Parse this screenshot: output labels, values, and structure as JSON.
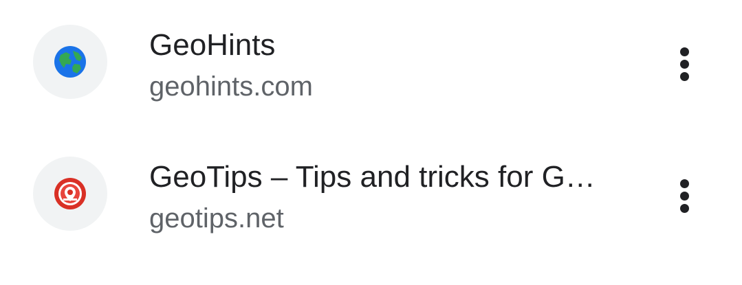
{
  "suggestions": [
    {
      "title": "GeoHints",
      "url": "geohints.com",
      "icon": "globe-icon",
      "icon_colors": {
        "ocean": "#1a73e8",
        "land": "#34a853"
      }
    },
    {
      "title": "GeoTips – Tips and tricks for G…",
      "url": "geotips.net",
      "icon": "geotips-logo-icon",
      "icon_colors": {
        "ring": "#d93025",
        "inner": "#ffffff"
      }
    }
  ],
  "colors": {
    "title_text": "#202124",
    "url_text": "#5f6368",
    "icon_background": "#f1f3f4",
    "menu_dots": "#202124"
  }
}
